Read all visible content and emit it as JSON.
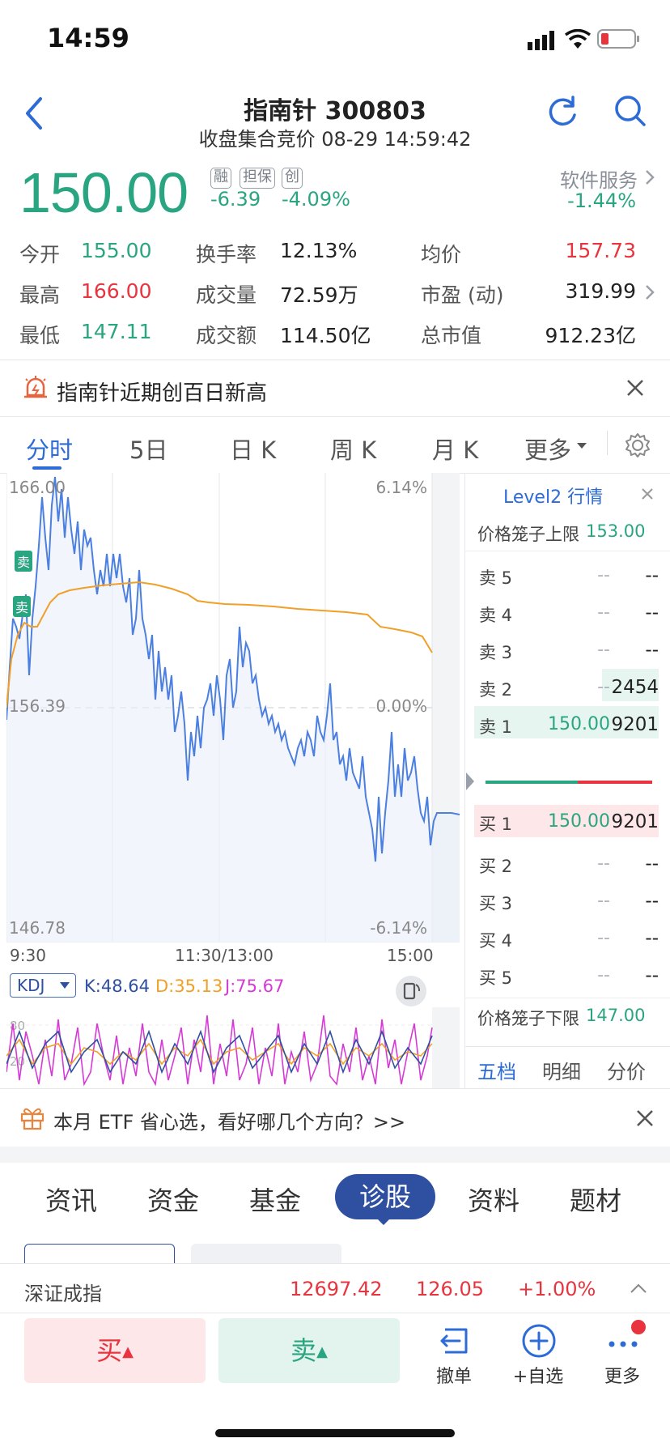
{
  "status_bar": {
    "time": "14:59"
  },
  "header": {
    "title": "指南针 300803",
    "subtitle": "收盘集合竞价 08-29 14:59:42"
  },
  "quote": {
    "price": "150.00",
    "tags": [
      "融",
      "担保",
      "创"
    ],
    "change": "-6.39",
    "change_pct": "-4.09%",
    "sector": "软件服务",
    "sector_pct": "-1.44%"
  },
  "stats": {
    "open_label": "今开",
    "open": "155.00",
    "high_label": "最高",
    "high": "166.00",
    "low_label": "最低",
    "low": "147.11",
    "turnover_rate_label": "换手率",
    "turnover_rate": "12.13%",
    "volume_label": "成交量",
    "volume": "72.59万",
    "amount_label": "成交额",
    "amount": "114.50亿",
    "avg_label": "均价",
    "avg": "157.73",
    "pe_label": "市盈 (动)",
    "pe": "319.99",
    "mktcap_label": "总市值",
    "mktcap": "912.23亿"
  },
  "notice": {
    "text": "指南针近期创百日新高"
  },
  "chart_tabs": [
    "分时",
    "5日",
    "日 K",
    "周 K",
    "月 K",
    "更多"
  ],
  "chart": {
    "y_top": "166.00",
    "y_mid": "156.39",
    "y_bot": "146.78",
    "pct_top": "6.14%",
    "pct_mid": "0.00%",
    "pct_bot": "-6.14%",
    "x_start": "9:30",
    "x_mid": "11:30/13:00",
    "x_end": "15:00",
    "sell_marker": "卖"
  },
  "kdj": {
    "label": "KDJ",
    "k": "K:48.64",
    "d": "D:35.13",
    "j": "J:75.67",
    "level_hi": "80",
    "level_lo": "20"
  },
  "orderbook": {
    "title": "Level2 行情",
    "upper_limit_label": "价格笼子上限",
    "upper_limit": "153.00",
    "lower_limit_label": "价格笼子下限",
    "lower_limit": "147.00",
    "asks": [
      {
        "label": "卖 5",
        "price": "--",
        "vol": "--"
      },
      {
        "label": "卖 4",
        "price": "--",
        "vol": "--"
      },
      {
        "label": "卖 3",
        "price": "--",
        "vol": "--"
      },
      {
        "label": "卖 2",
        "price": "--",
        "vol": "2454"
      },
      {
        "label": "卖 1",
        "price": "150.00",
        "vol": "9201"
      }
    ],
    "bids": [
      {
        "label": "买 1",
        "price": "150.00",
        "vol": "9201"
      },
      {
        "label": "买 2",
        "price": "--",
        "vol": "--"
      },
      {
        "label": "买 3",
        "price": "--",
        "vol": "--"
      },
      {
        "label": "买 4",
        "price": "--",
        "vol": "--"
      },
      {
        "label": "买 5",
        "price": "--",
        "vol": "--"
      }
    ],
    "tabs": [
      "五档",
      "明细",
      "分价"
    ]
  },
  "promo": {
    "text": "本月 ETF 省心选，看好哪几个方向？>>"
  },
  "section_tabs": [
    "资讯",
    "资金",
    "基金",
    "诊股",
    "资料",
    "题材"
  ],
  "index_bar": {
    "name": "深证成指",
    "value": "12697.42",
    "change": "126.05",
    "pct": "+1.00%"
  },
  "bottom_bar": {
    "buy": "买",
    "sell": "卖",
    "cancel": "撤单",
    "watch": "+自选",
    "more": "更多"
  },
  "colors": {
    "up": "#e8343e",
    "down": "#2aa581",
    "accent": "#2d6bd6"
  }
}
